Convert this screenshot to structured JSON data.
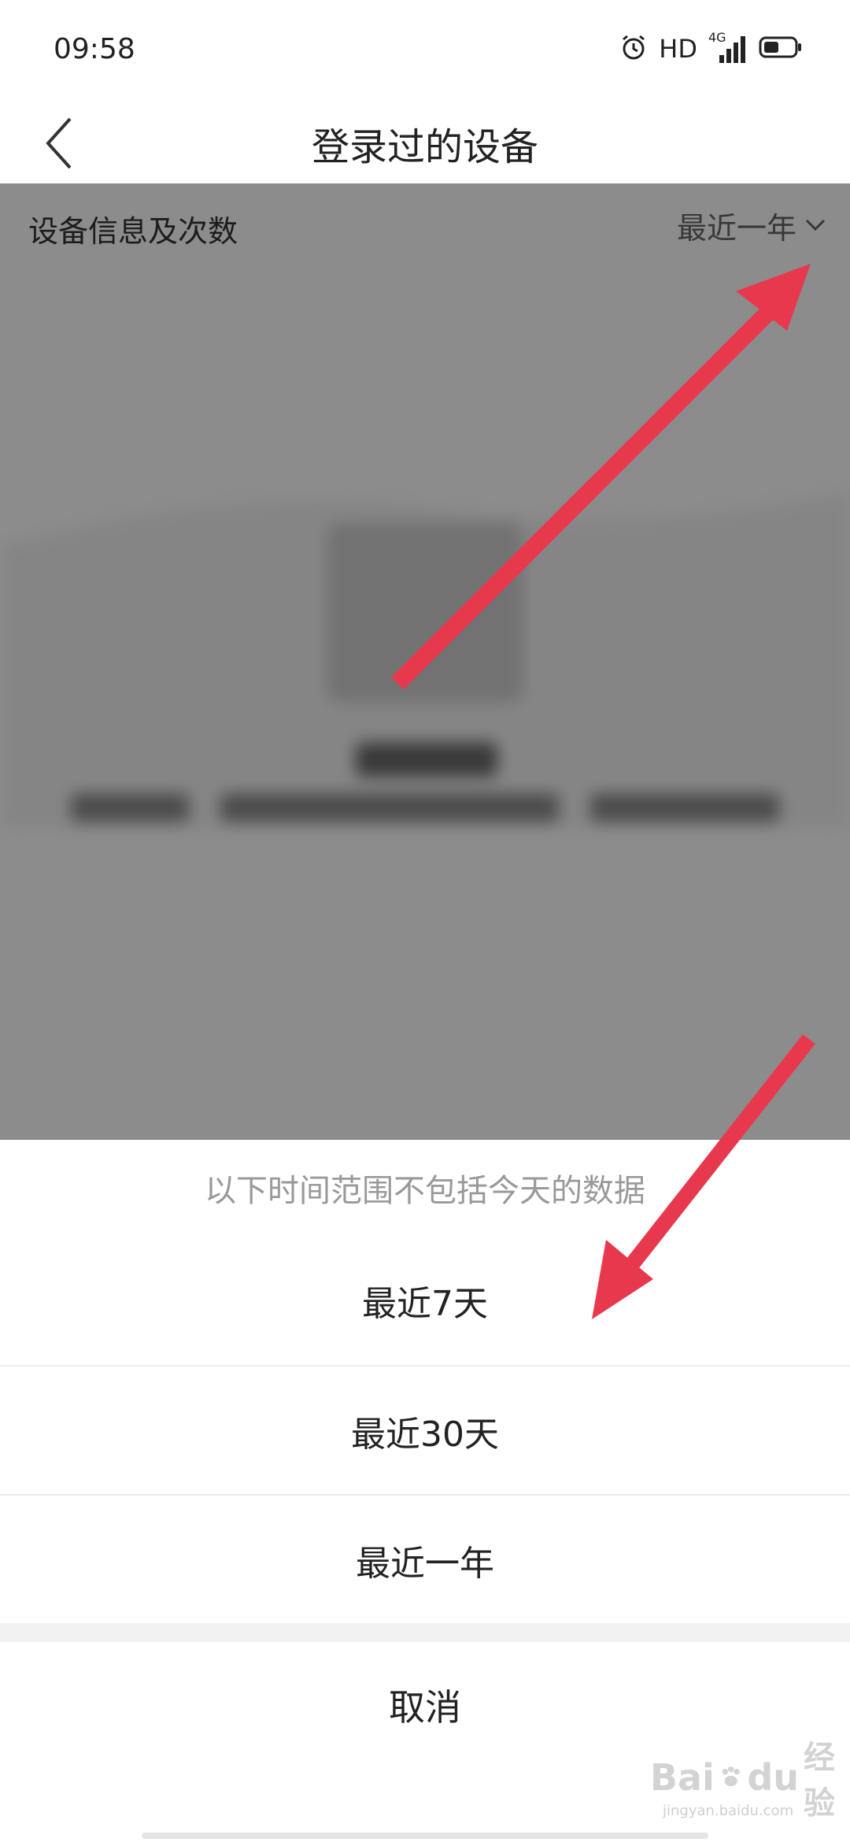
{
  "status_bar": {
    "time": "09:58",
    "hd": "HD",
    "network": "4G",
    "icons": [
      "alarm-icon",
      "signal-icon",
      "battery-icon"
    ]
  },
  "header": {
    "back_icon": "chevron-left-icon",
    "title": "登录过的设备"
  },
  "content": {
    "section_label": "设备信息及次数",
    "range_value": "最近一年",
    "range_icon": "chevron-down-icon"
  },
  "action_sheet": {
    "note": "以下时间范围不包括今天的数据",
    "options": [
      {
        "label": "最近7天"
      },
      {
        "label": "最近30天"
      },
      {
        "label": "最近一年"
      }
    ],
    "cancel": "取消"
  },
  "watermark": {
    "text": "Bai",
    "text2": "du",
    "text3": "经验",
    "sub": "jingyan.baidu.com"
  },
  "colors": {
    "annotation_arrow": "#e8384d",
    "overlay": "rgba(0,0,0,0.45)",
    "note_text": "#999999"
  }
}
